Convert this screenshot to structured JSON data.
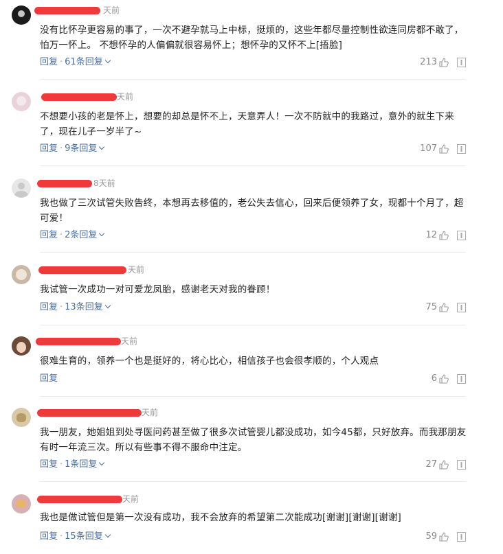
{
  "comments": [
    {
      "time": "天前",
      "avatar": "dark",
      "text": "没有比怀孕更容易的事了，一次不避孕就马上中标，挺烦的，这些年都尽量控制性欲连同房都不敢了，怕万一怀上。 不想怀孕的人偏偏就很容易怀上；想怀孕的又怀不上[捂脸]",
      "reply": "回复",
      "replies": "61条回复",
      "likes": "213"
    },
    {
      "time": "天前",
      "avatar": "pink",
      "text": "不想要小孩的老是怀上，想要的却总是怀不上，天意弄人！一次不防就中的我路过，意外的就生下来了，现在儿子一岁半了~",
      "reply": "回复",
      "replies": "9条回复",
      "likes": "107"
    },
    {
      "time": "8天前",
      "avatar": "grey",
      "text": "我也做了三次试管失败告终，本想再去移值的，老公失去信心，回来后便领养了女，现都十个月了，超可爱！",
      "reply": "回复",
      "replies": "2条回复",
      "likes": "12"
    },
    {
      "time": "天前",
      "avatar": "cat",
      "text": "我试管一次成功一对可爱龙凤胎，感谢老天对我的眷顾！",
      "reply": "回复",
      "replies": "13条回复",
      "likes": "75"
    },
    {
      "time": "天前",
      "avatar": "girl",
      "text": "很难生育的，领养一个也是挺好的，将心比心，相信孩子也会很孝顺的，个人观点",
      "reply": "回复",
      "replies": "",
      "likes": "6"
    },
    {
      "time": "天前",
      "avatar": "dog",
      "text": "我一朋友，她姐姐到处寻医问药甚至做了很多次试管婴儿都没成功，如今45都，只好放弃。而我那朋友有时一年流三次。所以有些事不得不服命中注定。",
      "reply": "回复",
      "replies": "1条回复",
      "likes": "27"
    },
    {
      "time": "天前",
      "avatar": "rose",
      "text": "我也是做试管但是第一次没有成功，我不会放弃的希望第二次能成功[谢谢][谢谢][谢谢]",
      "reply": "回复",
      "replies": "15条回复",
      "likes": "59"
    }
  ],
  "separator": "·",
  "icons": {
    "like": "thumbs-up-icon",
    "report": "report-icon",
    "expand": "chevron-down-icon"
  }
}
